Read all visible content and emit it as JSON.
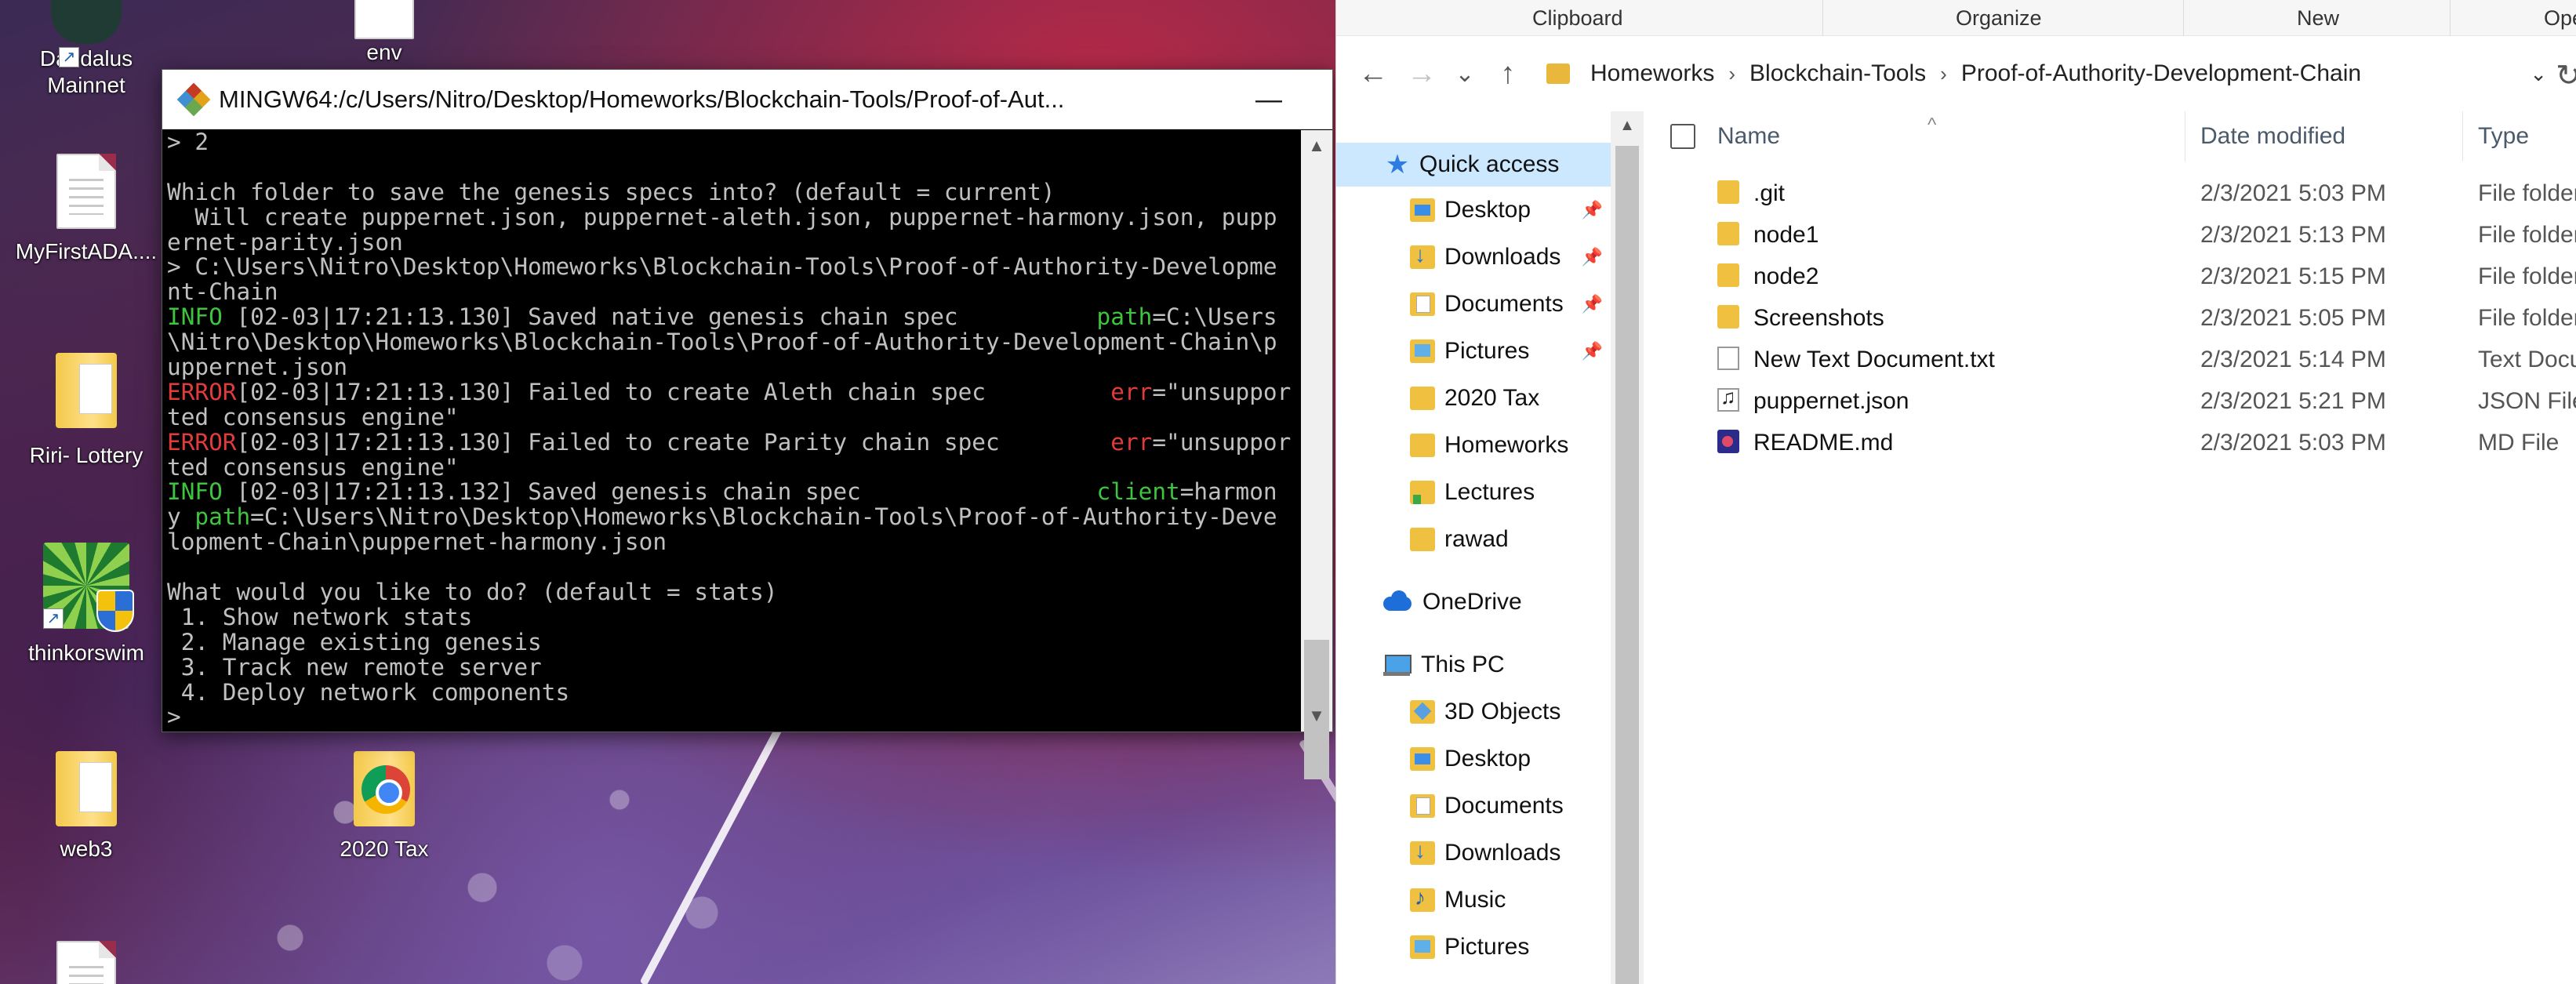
{
  "desktop": {
    "icons": {
      "daedalus": "Daedalus\nMainnet",
      "env": "env",
      "myfirstada": "MyFirstADA....",
      "riri": "Riri- Lottery",
      "thinkorswim": "thinkorswim",
      "web3": "web3",
      "tax2020": "2020 Tax"
    }
  },
  "terminal": {
    "title": "MINGW64:/c/Users/Nitro/Desktop/Homeworks/Blockchain-Tools/Proof-of-Aut...",
    "controls": {
      "minimize": "—",
      "maximize": "☐",
      "close": "✕"
    },
    "lines": [
      [
        {
          "t": "> 2",
          "c": "c-gray"
        }
      ],
      [
        {
          "t": "",
          "c": "c-gray"
        }
      ],
      [
        {
          "t": "Which folder to save the genesis specs into? (default = current)",
          "c": "c-gray"
        }
      ],
      [
        {
          "t": "  Will create puppernet.json, puppernet-aleth.json, puppernet-harmony.json, pupp",
          "c": "c-gray"
        }
      ],
      [
        {
          "t": "ernet-parity.json",
          "c": "c-gray"
        }
      ],
      [
        {
          "t": "> C:\\Users\\Nitro\\Desktop\\Homeworks\\Blockchain-Tools\\Proof-of-Authority-Developme",
          "c": "c-gray"
        }
      ],
      [
        {
          "t": "nt-Chain",
          "c": "c-gray"
        }
      ],
      [
        {
          "t": "INFO",
          "c": "c-green"
        },
        {
          "t": " [02-03|17:21:13.130] Saved native genesis chain spec          ",
          "c": "c-gray"
        },
        {
          "t": "path",
          "c": "c-green"
        },
        {
          "t": "=C:\\Users",
          "c": "c-gray"
        }
      ],
      [
        {
          "t": "\\Nitro\\Desktop\\Homeworks\\Blockchain-Tools\\Proof-of-Authority-Development-Chain\\p",
          "c": "c-gray"
        }
      ],
      [
        {
          "t": "uppernet.json",
          "c": "c-gray"
        }
      ],
      [
        {
          "t": "ERROR",
          "c": "c-red"
        },
        {
          "t": "[02-03|17:21:13.130] Failed to create Aleth chain spec         ",
          "c": "c-gray"
        },
        {
          "t": "err",
          "c": "c-red"
        },
        {
          "t": "=\"unsuppor",
          "c": "c-gray"
        }
      ],
      [
        {
          "t": "ted consensus engine\"",
          "c": "c-gray"
        }
      ],
      [
        {
          "t": "ERROR",
          "c": "c-red"
        },
        {
          "t": "[02-03|17:21:13.130] Failed to create Parity chain spec        ",
          "c": "c-gray"
        },
        {
          "t": "err",
          "c": "c-red"
        },
        {
          "t": "=\"unsuppor",
          "c": "c-gray"
        }
      ],
      [
        {
          "t": "ted consensus engine\"",
          "c": "c-gray"
        }
      ],
      [
        {
          "t": "INFO",
          "c": "c-green"
        },
        {
          "t": " [02-03|17:21:13.132] Saved genesis chain spec                 ",
          "c": "c-gray"
        },
        {
          "t": "client",
          "c": "c-green"
        },
        {
          "t": "=harmon",
          "c": "c-gray"
        }
      ],
      [
        {
          "t": "y ",
          "c": "c-gray"
        },
        {
          "t": "path",
          "c": "c-green"
        },
        {
          "t": "=C:\\Users\\Nitro\\Desktop\\Homeworks\\Blockchain-Tools\\Proof-of-Authority-Deve",
          "c": "c-gray"
        }
      ],
      [
        {
          "t": "lopment-Chain\\puppernet-harmony.json",
          "c": "c-gray"
        }
      ],
      [
        {
          "t": "",
          "c": "c-gray"
        }
      ],
      [
        {
          "t": "What would you like to do? (default = stats)",
          "c": "c-gray"
        }
      ],
      [
        {
          "t": " 1. Show network stats",
          "c": "c-gray"
        }
      ],
      [
        {
          "t": " 2. Manage existing genesis",
          "c": "c-gray"
        }
      ],
      [
        {
          "t": " 3. Track new remote server",
          "c": "c-gray"
        }
      ],
      [
        {
          "t": " 4. Deploy network components",
          "c": "c-gray"
        }
      ],
      [
        {
          "t": "> ",
          "c": "c-gray"
        }
      ]
    ]
  },
  "explorer": {
    "ribbon": {
      "clipboard": "Clipboard",
      "organize": "Organize",
      "new": "New",
      "open": "Ope"
    },
    "nav_buttons": {
      "back": "←",
      "forward": "→",
      "recent": "⌄",
      "up": "↑"
    },
    "breadcrumb": [
      "Homeworks",
      "Blockchain-Tools",
      "Proof-of-Authority-Development-Chain"
    ],
    "breadcrumb_sep": "›",
    "dropdown": "⌄",
    "refresh": "↻",
    "nav_pane": {
      "quick_access": "Quick access",
      "items": [
        {
          "label": "Desktop",
          "pinned": true
        },
        {
          "label": "Downloads",
          "pinned": true
        },
        {
          "label": "Documents",
          "pinned": true
        },
        {
          "label": "Pictures",
          "pinned": true
        },
        {
          "label": "2020 Tax"
        },
        {
          "label": "Homeworks"
        },
        {
          "label": "Lectures"
        },
        {
          "label": "rawad"
        }
      ],
      "onedrive": "OneDrive",
      "this_pc": "This PC",
      "pc_items": [
        "3D Objects",
        "Desktop",
        "Documents",
        "Downloads",
        "Music",
        "Pictures"
      ],
      "pin_glyph": "📌"
    },
    "columns": {
      "name": "Name",
      "date": "Date modified",
      "type": "Type",
      "sort_caret": "^"
    },
    "files": [
      {
        "name": ".git",
        "date": "2/3/2021 5:03 PM",
        "type": "File folder",
        "icon": "folder"
      },
      {
        "name": "node1",
        "date": "2/3/2021 5:13 PM",
        "type": "File folder",
        "icon": "folder"
      },
      {
        "name": "node2",
        "date": "2/3/2021 5:15 PM",
        "type": "File folder",
        "icon": "folder"
      },
      {
        "name": "Screenshots",
        "date": "2/3/2021 5:05 PM",
        "type": "File folder",
        "icon": "folder"
      },
      {
        "name": "New Text Document.txt",
        "date": "2/3/2021 5:14 PM",
        "type": "Text Docu",
        "icon": "txt"
      },
      {
        "name": "puppernet.json",
        "date": "2/3/2021 5:21 PM",
        "type": "JSON File",
        "icon": "json"
      },
      {
        "name": "README.md",
        "date": "2/3/2021 5:03 PM",
        "type": "MD File",
        "icon": "md"
      }
    ]
  }
}
